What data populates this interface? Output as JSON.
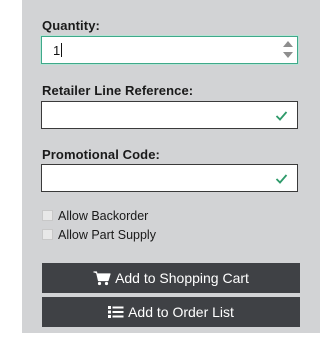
{
  "form": {
    "quantity": {
      "label": "Quantity:",
      "value": "1"
    },
    "retailer_line_reference": {
      "label": "Retailer Line Reference:",
      "value": ""
    },
    "promotional_code": {
      "label": "Promotional Code:",
      "value": ""
    },
    "options": {
      "allow_backorder": {
        "label": "Allow Backorder",
        "checked": false
      },
      "allow_part_supply": {
        "label": "Allow Part Supply",
        "checked": false
      }
    },
    "buttons": {
      "add_to_cart": {
        "label": "Add to Shopping Cart",
        "icon": "shopping-cart-icon"
      },
      "add_to_order_list": {
        "label": "Add to Order List",
        "icon": "list-icon"
      }
    }
  },
  "colors": {
    "panel_bg": "#d2d3d5",
    "button_bg": "#3f4145",
    "valid_check": "#2e9a6a",
    "focus_border": "#3fa98a"
  }
}
